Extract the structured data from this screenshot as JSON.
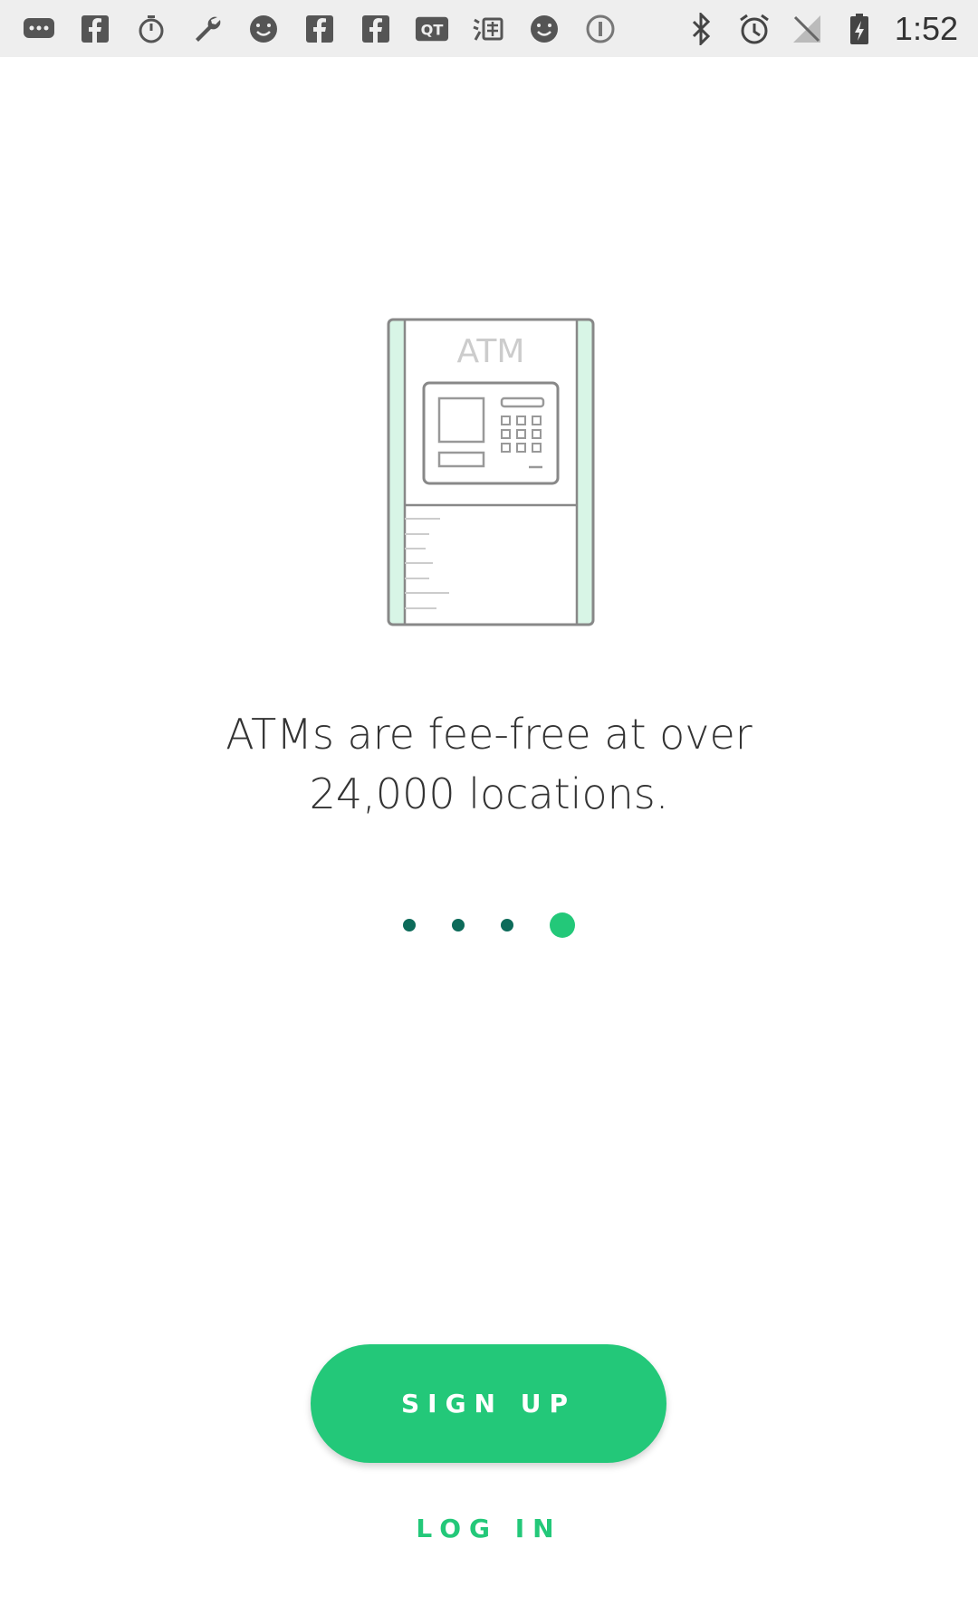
{
  "status_bar": {
    "time": "1:52",
    "left_icons": [
      "messages-icon",
      "facebook-icon",
      "stopwatch-icon",
      "wrench-icon",
      "smiley-icon",
      "facebook-icon",
      "facebook-icon",
      "qt-icon",
      "taobao-icon",
      "smiley-icon",
      "info-icon"
    ],
    "right_icons": [
      "bluetooth-icon",
      "alarm-icon",
      "no-signal-icon",
      "battery-charging-icon"
    ]
  },
  "illustration": {
    "atm_label": "ATM",
    "accent_color": "#d8f5e6",
    "stroke_color": "#888888"
  },
  "onboarding": {
    "headline_line1": "ATMs are fee-free at over",
    "headline_line2": "24,000 locations.",
    "page_count": 4,
    "active_page": 4
  },
  "actions": {
    "signup_label": "SIGN UP",
    "login_label": "LOG IN"
  },
  "colors": {
    "brand_green": "#23c879",
    "dot_dark": "#0d6b5a",
    "background": "#ffffff"
  }
}
